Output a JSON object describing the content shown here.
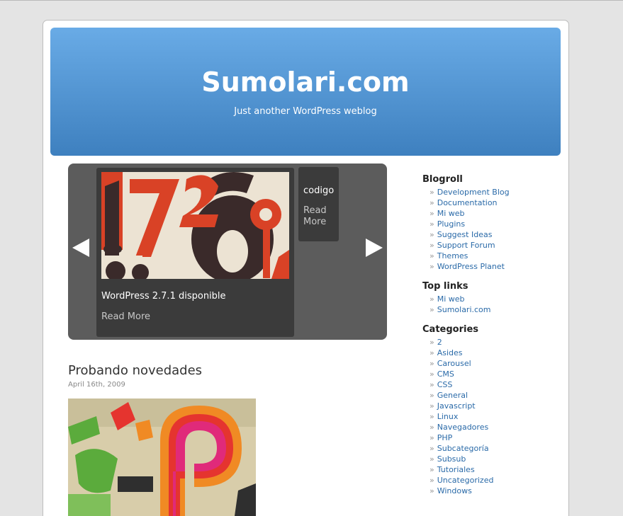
{
  "header": {
    "title": "Sumolari.com",
    "description": "Just another WordPress weblog"
  },
  "carousel": {
    "prev_icon": "left-arrow-icon",
    "next_icon": "right-arrow-icon",
    "main_slide": {
      "title": "WordPress 2.7.1 disponible",
      "more": "Read More"
    },
    "side_slide": {
      "title": "codigo",
      "more": "Read More"
    }
  },
  "post": {
    "title": "Probando novedades",
    "date": "April 16th, 2009"
  },
  "sidebar": {
    "blogroll": {
      "title": "Blogroll",
      "items": [
        "Development Blog",
        "Documentation",
        "Mi web",
        "Plugins",
        "Suggest Ideas",
        "Support Forum",
        "Themes",
        "WordPress Planet"
      ]
    },
    "toplinks": {
      "title": "Top links",
      "items": [
        "Mi web",
        "Sumolari.com"
      ]
    },
    "categories": {
      "title": "Categories",
      "items": [
        "2",
        "Asides",
        "Carousel",
        "CMS",
        "CSS",
        "General",
        "Javascript",
        "Linux",
        "Navegadores",
        "PHP",
        "Subcategoría",
        "Subsub",
        "Tutoriales",
        "Uncategorized",
        "Windows"
      ]
    },
    "bullet": "»"
  },
  "colors": {
    "header_top": "#69abe6",
    "header_bottom": "#3e80bf",
    "carousel_bg": "#5c5c5c",
    "slide_bg": "#3b3b3b",
    "link": "#2a6aa8"
  }
}
